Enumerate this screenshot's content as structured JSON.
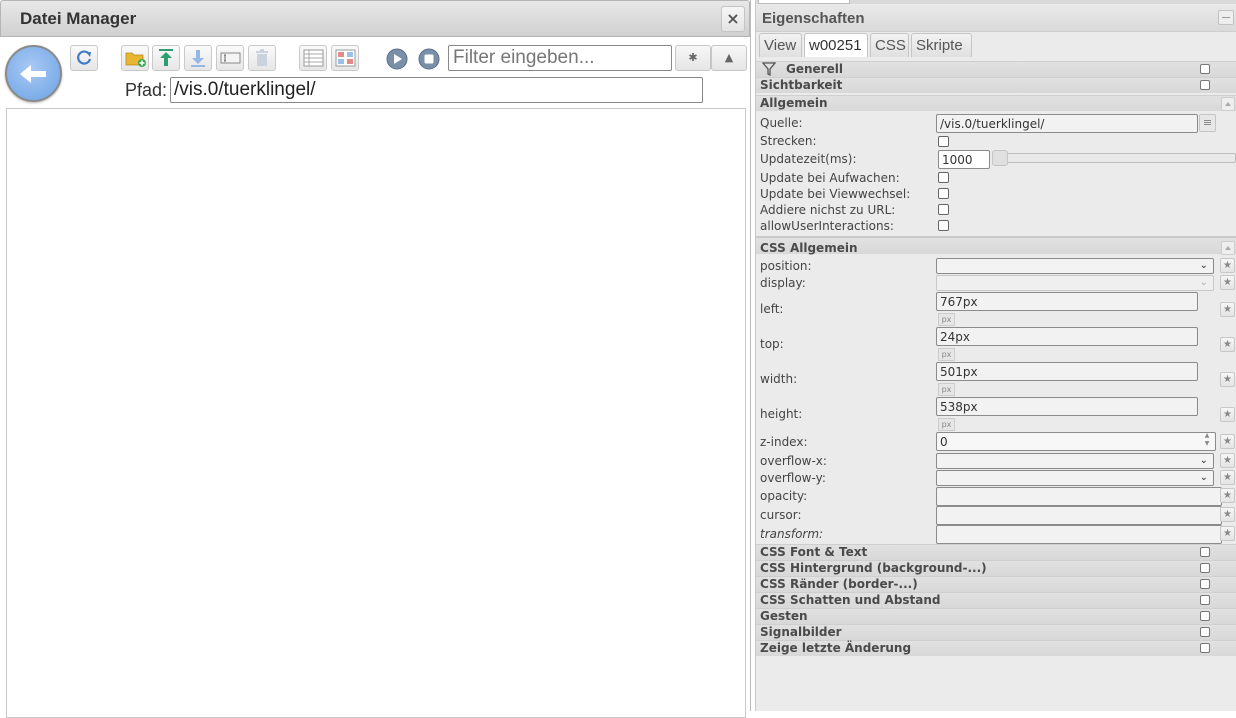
{
  "file_manager": {
    "title": "Datei Manager",
    "close_label": "×",
    "filter": {
      "placeholder": "Filter eingeben...",
      "value": ""
    },
    "path_label": "Pfad:",
    "path_value": "/vis.0/tuerklingel/",
    "toolbar": [
      "refresh-icon",
      "new-folder-icon",
      "upload-icon",
      "download-icon",
      "rename-icon",
      "delete-icon",
      "list-view-icon",
      "grid-view-icon",
      "play-icon",
      "stop-icon"
    ],
    "settings_glyph": "✱",
    "warning_glyph": "▲",
    "colors": {
      "back_button": "#7eaeea",
      "folder": "#e8b631",
      "green": "#2e9e6e"
    }
  },
  "properties": {
    "title": "Eigenschaften",
    "tabs": [
      "View",
      "w00251",
      "CSS",
      "Skripte"
    ],
    "active_tab": "w00251",
    "sections": {
      "generell": "Generell",
      "sichtbarkeit": "Sichtbarkeit",
      "allgemein": "Allgemein",
      "css_allgemein": "CSS Allgemein"
    },
    "allgemein": {
      "quelle_label": "Quelle:",
      "quelle_value": "/vis.0/tuerklingel/",
      "strecken_label": "Strecken:",
      "update_label": "Updatezeit(ms):",
      "update_value": "1000",
      "aufwachen_label": "Update bei Aufwachen:",
      "viewwechsel_label": "Update bei Viewwechsel:",
      "url_label": "Addiere nichst zu URL:",
      "interactions_label": "allowUserInteractions:"
    },
    "css": {
      "position_label": "position:",
      "display_label": "display:",
      "left_label": "left:",
      "left_value": "767px",
      "top_label": "top:",
      "top_value": "24px",
      "width_label": "width:",
      "width_value": "501px",
      "height_label": "height:",
      "height_value": "538px",
      "unit": "px",
      "zindex_label": "z-index:",
      "zindex_value": "0",
      "overflowx_label": "overflow-x:",
      "overflowy_label": "overflow-y:",
      "opacity_label": "opacity:",
      "cursor_label": "cursor:",
      "transform_label": "transform:"
    },
    "bottom_sections": [
      "CSS Font & Text",
      "CSS Hintergrund (background-...)",
      "CSS Ränder (border-...)",
      "CSS Schatten und Abstand",
      "Gesten",
      "Signalbilder",
      "Zeige letzte Änderung"
    ],
    "star_glyph": "★",
    "chevron_glyph": "⌄"
  }
}
